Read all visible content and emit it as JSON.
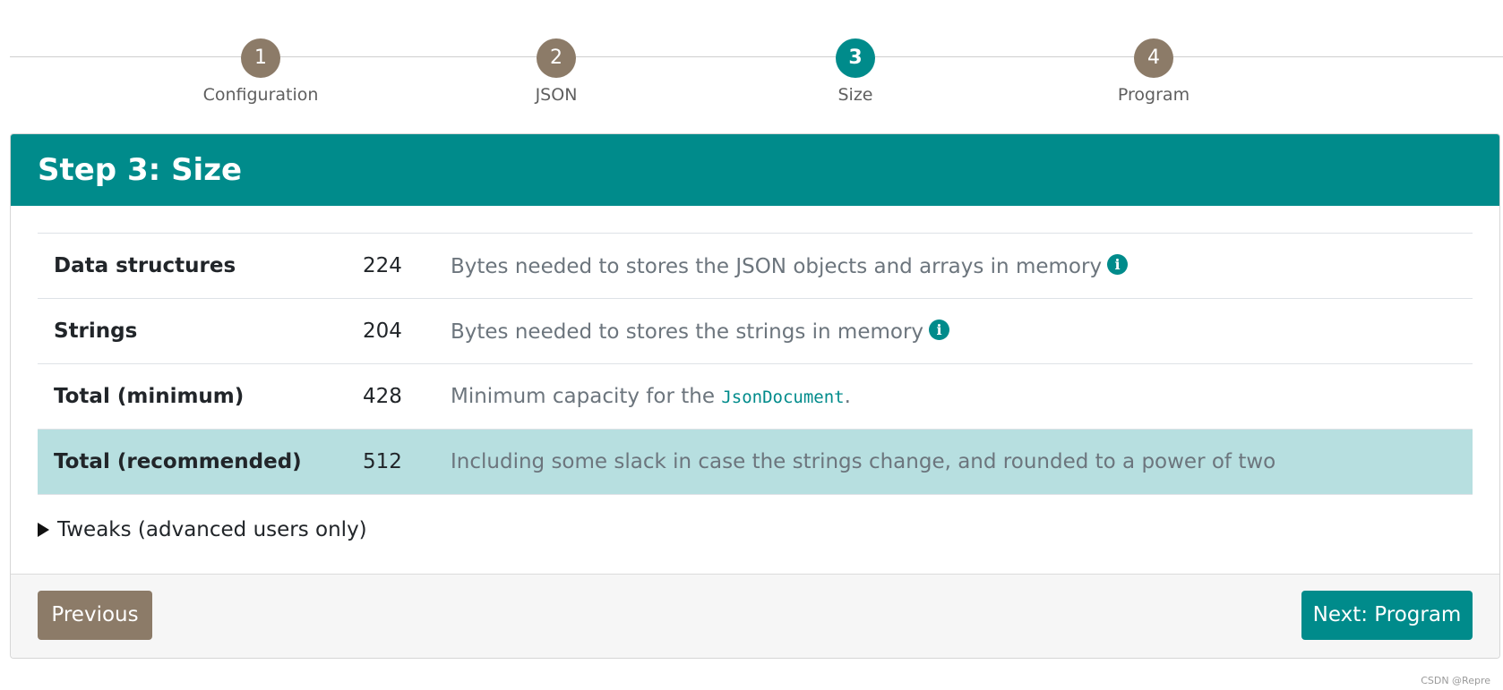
{
  "stepper": {
    "steps": [
      {
        "number": "1",
        "label": "Configuration"
      },
      {
        "number": "2",
        "label": "JSON"
      },
      {
        "number": "3",
        "label": "Size"
      },
      {
        "number": "4",
        "label": "Program"
      }
    ],
    "active_step": "3"
  },
  "card": {
    "title": "Step 3: Size"
  },
  "size_table": {
    "rows": [
      {
        "name": "Data structures",
        "value": "224",
        "description": "Bytes needed to stores the JSON objects and arrays in memory",
        "icon": "info-icon"
      },
      {
        "name": "Strings",
        "value": "204",
        "description": "Bytes needed to stores the strings in memory",
        "icon": "info-icon"
      },
      {
        "name": "Total (minimum)",
        "value": "428",
        "description_prefix": "Minimum capacity for the ",
        "code": "JsonDocument",
        "description_suffix": "."
      },
      {
        "name": "Total (recommended)",
        "value": "512",
        "description": "Including some slack in case the strings change, and rounded to a power of two",
        "highlighted": true
      }
    ]
  },
  "tweaks": {
    "label": "Tweaks (advanced users only)",
    "expanded": false
  },
  "footer": {
    "previous_label": "Previous",
    "next_label": "Next: Program"
  },
  "watermark": "CSDN @Repre",
  "colors": {
    "accent": "#008b8b",
    "secondary": "#8c7b68",
    "highlight_row": "#b7dfe0"
  }
}
